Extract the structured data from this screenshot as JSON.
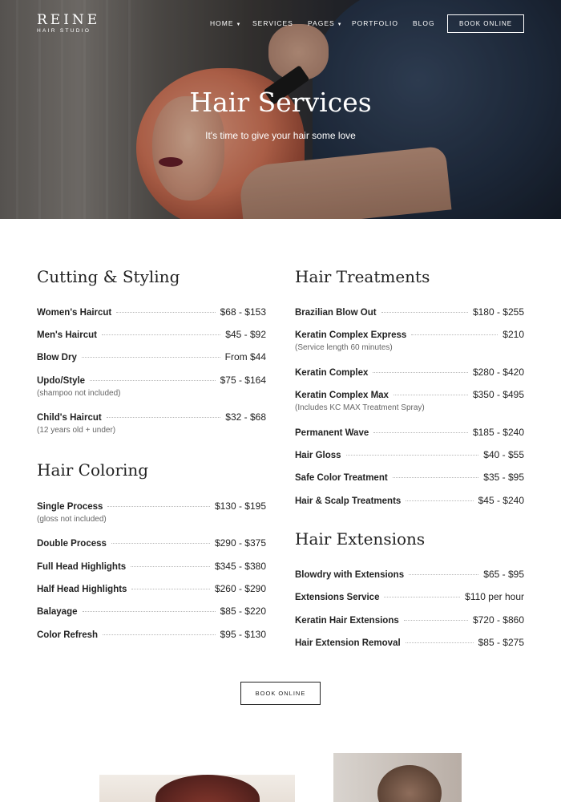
{
  "brand": {
    "name": "REINE",
    "tagline": "HAIR STUDIO"
  },
  "nav": {
    "items": [
      {
        "label": "HOME",
        "has_dropdown": true
      },
      {
        "label": "SERVICES",
        "has_dropdown": false
      },
      {
        "label": "PAGES",
        "has_dropdown": true
      },
      {
        "label": "PORTFOLIO",
        "has_dropdown": false
      },
      {
        "label": "BLOG",
        "has_dropdown": false
      }
    ],
    "book_label": "BOOK ONLINE"
  },
  "hero": {
    "title": "Hair Services",
    "subtitle": "It's time to give your hair some love"
  },
  "sections": {
    "cutting": {
      "title": "Cutting & Styling",
      "items": [
        {
          "name": "Women's Haircut",
          "price": "$68 - $153"
        },
        {
          "name": "Men's Haircut",
          "price": "$45 - $92"
        },
        {
          "name": "Blow Dry",
          "price": "From $44"
        },
        {
          "name": "Updo/Style",
          "price": "$75 - $164",
          "note": "(shampoo not included)"
        },
        {
          "name": "Child's Haircut",
          "price": "$32 - $68",
          "note": "(12 years old + under)"
        }
      ]
    },
    "coloring": {
      "title": "Hair Coloring",
      "items": [
        {
          "name": "Single Process",
          "price": "$130 - $195",
          "note": "(gloss not included)"
        },
        {
          "name": "Double Process",
          "price": "$290 - $375"
        },
        {
          "name": "Full Head Highlights",
          "price": "$345 - $380"
        },
        {
          "name": "Half Head Highlights",
          "price": "$260 - $290"
        },
        {
          "name": "Balayage",
          "price": "$85 - $220"
        },
        {
          "name": "Color Refresh",
          "price": "$95 - $130"
        }
      ]
    },
    "treatments": {
      "title": "Hair Treatments",
      "items": [
        {
          "name": "Brazilian Blow Out",
          "price": "$180 - $255"
        },
        {
          "name": "Keratin Complex Express",
          "price": "$210",
          "note": "(Service length 60 minutes)"
        },
        {
          "name": "Keratin Complex",
          "price": "$280 - $420"
        },
        {
          "name": "Keratin Complex Max",
          "price": "$350 - $495",
          "note": "(Includes KC MAX Treatment Spray)"
        },
        {
          "name": "Permanent Wave",
          "price": "$185 - $240"
        },
        {
          "name": "Hair Gloss",
          "price": "$40 - $55"
        },
        {
          "name": "Safe Color Treatment",
          "price": "$35 - $95"
        },
        {
          "name": "Hair & Scalp Treatments",
          "price": "$45 - $240"
        }
      ]
    },
    "extensions": {
      "title": "Hair Extensions",
      "items": [
        {
          "name": "Blowdry with Extensions",
          "price": "$65 - $95"
        },
        {
          "name": "Extensions Service",
          "price": "$110 per hour"
        },
        {
          "name": "Keratin Hair Extensions",
          "price": "$720 - $860"
        },
        {
          "name": "Hair Extension Removal",
          "price": "$85 - $275"
        }
      ]
    }
  },
  "cta": {
    "book_label": "BOOK ONLINE"
  }
}
